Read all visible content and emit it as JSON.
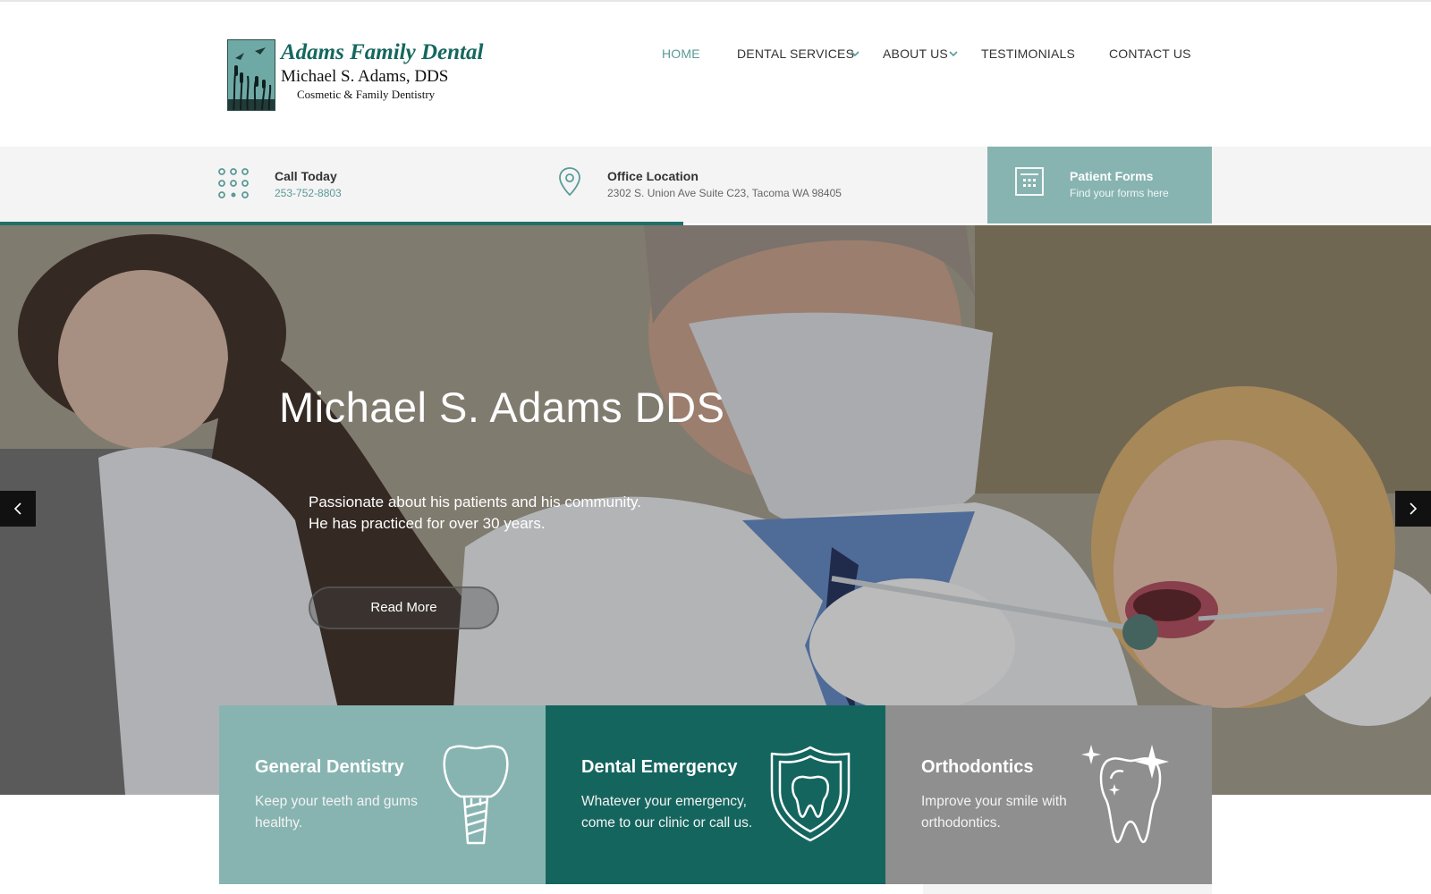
{
  "brand": {
    "name": "Adams Family Dental",
    "doctor": "Michael S. Adams, DDS",
    "tagline": "Cosmetic & Family Dentistry"
  },
  "nav": {
    "items": [
      {
        "label": "HOME",
        "active": true
      },
      {
        "label": "DENTAL SERVICES",
        "has_dropdown": true
      },
      {
        "label": "ABOUT US",
        "has_dropdown": true
      },
      {
        "label": "TESTIMONIALS"
      },
      {
        "label": "CONTACT US"
      }
    ]
  },
  "infobar": {
    "call": {
      "title": "Call Today",
      "phone": "253-752-8803",
      "icon": "dialpad-icon"
    },
    "location": {
      "title": "Office Location",
      "address": "2302 S. Union Ave Suite C23, Tacoma WA 98405",
      "icon": "map-pin-icon"
    },
    "forms": {
      "title": "Patient Forms",
      "subtitle": "Find your forms here",
      "icon": "calculator-form-icon"
    }
  },
  "hero": {
    "title": "Michael S. Adams DDS",
    "line1": "Passionate about his patients and his community.",
    "line2": "He has practiced for over 30 years.",
    "button": "Read More"
  },
  "cards": [
    {
      "title": "General Dentistry",
      "line1": "Keep your teeth and gums",
      "line2": "healthy.",
      "icon": "tooth-implant-icon",
      "color": "#87b4b1"
    },
    {
      "title": "Dental Emergency",
      "line1": "Whatever your emergency,",
      "line2": "come to our clinic or call us.",
      "icon": "tooth-shield-icon",
      "color": "#15655f"
    },
    {
      "title": "Orthodontics",
      "line1": "Improve your smile with",
      "line2": "orthodontics.",
      "icon": "sparkling-tooth-icon",
      "color": "#8f8f8f"
    }
  ],
  "colors": {
    "accent": "#5a9a98",
    "dark_teal": "#15655f",
    "light_teal": "#87b4b1"
  }
}
